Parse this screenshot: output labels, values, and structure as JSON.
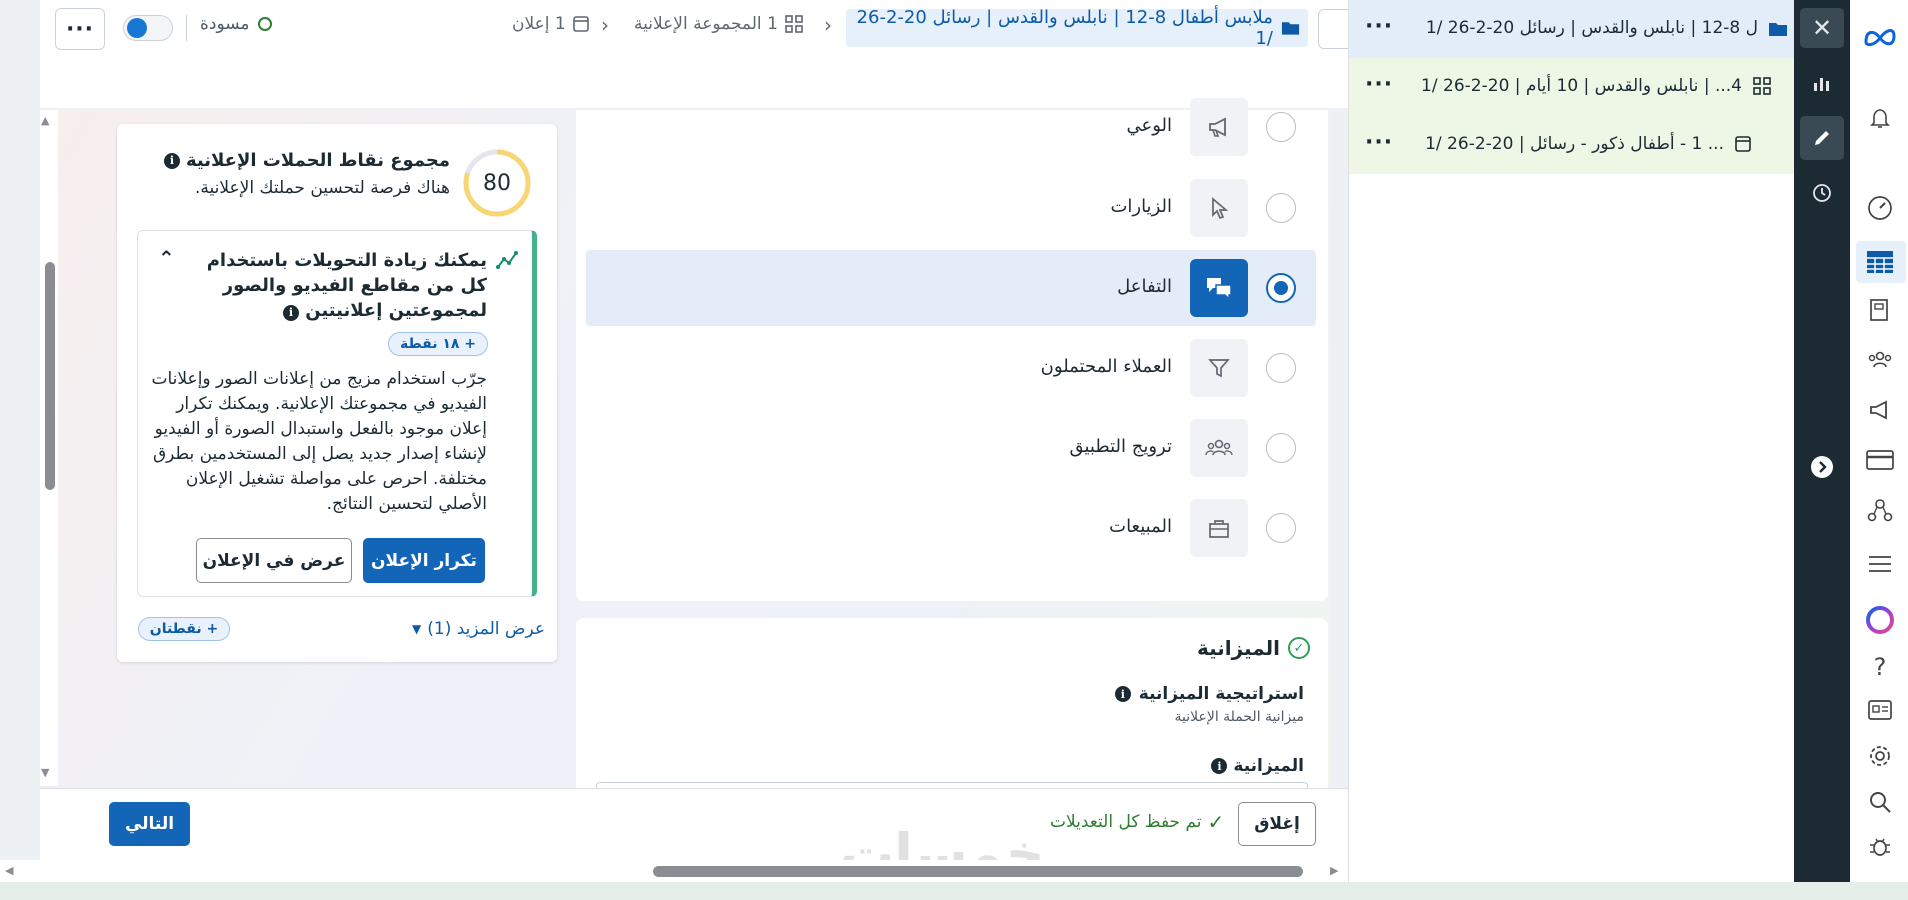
{
  "topbar": {
    "draft_label": "مسودة",
    "ad_count": "1 إعلان",
    "adset_count": "1 المجموعة الإعلانية",
    "campaign_crumb": "ملابس أطفال 8-12 | نابلس والقدس | رسائل 20-2-26 /1"
  },
  "score": {
    "value": "80",
    "title": "مجموع نقاط الحملات الإعلانية",
    "subtitle": "هناك فرصة لتحسين حملتك الإعلانية.",
    "rec_title": "يمكنك زيادة التحويلات باستخدام كل من مقاطع الفيديو والصور لمجموعتين إعلانيتين",
    "rec_points": "+ ١٨ نقطة",
    "rec_body": "جرّب استخدام مزيج من إعلانات الصور وإعلانات الفيديو في مجموعتك الإعلانية. ويمكنك تكرار إعلان موجود بالفعل واستبدال الصورة أو الفيديو لإنشاء إصدار جديد يصل إلى المستخدمين بطرق مختلفة. احرص على مواصلة تشغيل الإعلان الأصلي لتحسين النتائج.",
    "duplicate_btn": "تكرار الإعلان",
    "view_ad_btn": "عرض في الإعلان",
    "show_more": "عرض المزيد (1)",
    "more_points": "+ نقطتان"
  },
  "objectives": [
    {
      "label": "الوعي",
      "icon": "megaphone-icon",
      "selected": false
    },
    {
      "label": "الزيارات",
      "icon": "cursor-icon",
      "selected": false
    },
    {
      "label": "التفاعل",
      "icon": "chat-bubbles-icon",
      "selected": true
    },
    {
      "label": "العملاء المحتملون",
      "icon": "funnel-icon",
      "selected": false
    },
    {
      "label": "ترويج التطبيق",
      "icon": "people-icon",
      "selected": false
    },
    {
      "label": "المبيعات",
      "icon": "shopping-bag-icon",
      "selected": false
    }
  ],
  "budget": {
    "title": "الميزانية",
    "strategy_label": "استراتيجية الميزانية",
    "strategy_value": "ميزانية الحملة الإعلانية",
    "budget_label": "الميزانية"
  },
  "bottom": {
    "close_btn": "إغلاق",
    "saved_text": "تم حفظ كل التعديلات",
    "next_btn": "التالي",
    "watermark": "خمسات"
  },
  "tree": [
    {
      "text": "ل 8-12 | نابلس والقدس | رسائل 20-2-26 /1",
      "icon": "folder-icon"
    },
    {
      "text": "4... | نابلس والقدس | 10 أيام | 20-2-26 /1",
      "icon": "grid-icon"
    },
    {
      "text": "... 1 - أطفال ذكور - رسائل | 20-2-26 /1",
      "icon": "ad-icon"
    }
  ],
  "nav": {
    "help": "?"
  },
  "colors": {
    "primary": "#1366b7",
    "selected_bg": "#e3ecf7",
    "success": "#2e7d32",
    "dark_sidebar": "#1c2b33"
  }
}
